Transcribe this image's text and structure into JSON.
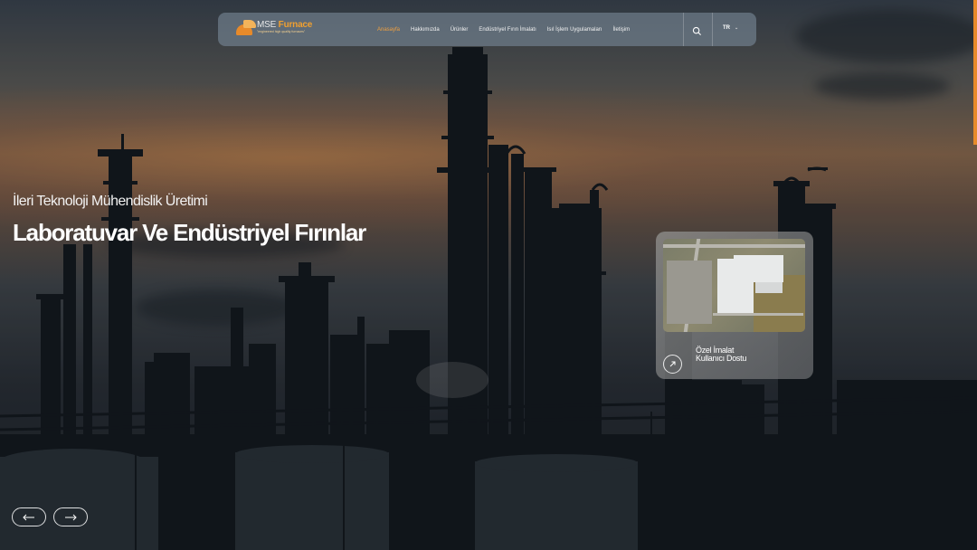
{
  "logo": {
    "name_part1": "MSE",
    "name_part2": " Furnace",
    "tagline": "\"engineered high quality furnaces\""
  },
  "nav": {
    "items": [
      {
        "label": "Anasayfa",
        "active": true
      },
      {
        "label": "Hakkımızda",
        "active": false
      },
      {
        "label": "Ürünler",
        "active": false
      },
      {
        "label": "Endüstriyel Fırın İmalatı",
        "active": false
      },
      {
        "label": "Isıl İşlem Uygulamaları",
        "active": false
      },
      {
        "label": "İletişim",
        "active": false
      }
    ],
    "search_icon": "search-icon",
    "language": "TR"
  },
  "hero": {
    "subtitle": "İleri Teknoloji Mühendislik Üretimi",
    "title": "Laboratuvar Ve Endüstriyel Fırınlar"
  },
  "card": {
    "line1": "Özel İmalat",
    "line2": "Kullanıcı Dostu",
    "arrow_icon": "arrow-up-right-icon"
  },
  "slider": {
    "prev_icon": "arrow-left-icon",
    "next_icon": "arrow-right-icon"
  },
  "colors": {
    "accent": "#f0a040",
    "brand_orange": "#e78a2a"
  }
}
